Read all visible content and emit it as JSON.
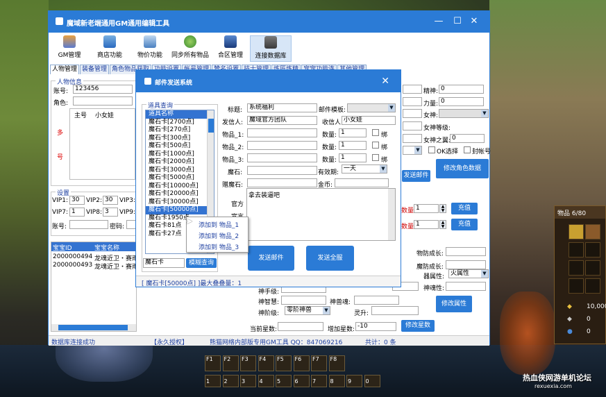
{
  "main_window": {
    "title": "魔域新老端通用GM通用编辑工具",
    "controls": {
      "minimize": "—",
      "maximize": "☐",
      "close": "✕"
    }
  },
  "toolbar": {
    "items": [
      {
        "label": "GM管理",
        "icon": "user-icon"
      },
      {
        "label": "商店功能",
        "icon": "shop-icon"
      },
      {
        "label": "物价功能",
        "icon": "price-icon"
      },
      {
        "label": "同步所有物品",
        "icon": "sync-icon"
      },
      {
        "label": "合区管理",
        "icon": "merge-icon"
      },
      {
        "label": "连接数据库",
        "icon": "database-icon"
      }
    ]
  },
  "tabs": [
    "人物管理",
    "装备管理",
    "角色物品获取",
    "功能设置",
    "帐号管理",
    "赞名设置",
    "技士管理",
    "炼匠炼精",
    "宠宠功能连",
    "其他管理"
  ],
  "character": {
    "group_title": "人物信息",
    "account_label": "账号:",
    "account_value": "123456",
    "role_label": "角色:",
    "role_list": {
      "col1": "主号",
      "col2": "小女娃",
      "side_label_1": "多",
      "side_label_2": "号"
    }
  },
  "right_panel": {
    "attr1_label": "精神:",
    "attr1_value": "0",
    "attr2_label": "力量:",
    "attr2_value": "0",
    "attr3_label": "女神:",
    "attr4_label": "女神等级:",
    "attr5_label": "女神之翼:",
    "attr5_value": "0",
    "check1": "OK选择",
    "check2": "封帐号",
    "modify_role_button": "修改角色数据",
    "send_mail_button": "发送邮件"
  },
  "vip_settings": {
    "group_title": "设置",
    "vip1_label": "VIP1:",
    "vip1_value": "30",
    "vip2_label": "VIP2:",
    "vip2_value": "30",
    "vip3_label": "VIP3:",
    "vip7_label": "VIP7:",
    "vip7_value": "1",
    "vip8_label": "VIP8:",
    "vip8_value": "3",
    "vip9_label": "VIP9:",
    "account_label": "账号:",
    "password_label": "密码:"
  },
  "pet_table": {
    "headers": [
      "宝宝ID",
      "宝宝名称"
    ],
    "rows": [
      [
        "2000000494",
        "龙魂近卫・赛雨"
      ],
      [
        "2000000493",
        "龙魂近卫・赛雨"
      ]
    ]
  },
  "recharge": {
    "row1_label": "数量:",
    "row1_value": "1",
    "row1_button": "充值",
    "row2_label": "数量:",
    "row2_value": "1",
    "row2_button": "充值"
  },
  "pet_attrs": {
    "growth_label": "物防成长:",
    "magic_growth_label": "魔防成长:",
    "element_label": "器属性:",
    "element_value": "火属性",
    "spirit_label": "神魂性:",
    "wisdom_label": "神智慧:",
    "level_label": "神阶级:",
    "level_value": "零阶神兽",
    "rank_label": "神手级:",
    "soul_label": "神兽魂:",
    "soul2_label": "灵升:",
    "modify_attr_button": "修改属性",
    "star_label": "当前星数:",
    "add_star_label": "增加星数:",
    "add_star_value": "-10",
    "modify_star_button": "修改星数"
  },
  "status_bar": {
    "db_status": "数据库连接成功",
    "license": "【永久授权】",
    "vendor": "熊猫网络内部版专用GM工具 QQ：847069216",
    "total": "共计：0 条"
  },
  "mail_window": {
    "title": "邮件发送系统",
    "item_query_title": "道具查询",
    "item_list": [
      "道具名称",
      "魔石卡[2700点]",
      "魔石卡[270点]",
      "魔石卡[300点]",
      "魔石卡[500点]",
      "魔石卡[1000点]",
      "魔石卡[2000点]",
      "魔石卡[3000点]",
      "魔石卡[5000点]",
      "魔石卡[10000点]",
      "魔石卡[20000点]",
      "魔石卡[30000点]",
      "魔石卡[50000点]",
      "魔石卡1950点",
      "魔石卡81点",
      "魔石卡27点"
    ],
    "selected_index": 12,
    "search_value": "魔石卡",
    "search_button": "模糊查询",
    "context_menu": [
      "添加到 物品_1",
      "添加到 物品_2",
      "添加到 物品_3"
    ],
    "subject_label": "标题:",
    "subject_value": "系统福利",
    "template_label": "邮件模板:",
    "sender_label": "发信人:",
    "sender_value": "魔域官方团队",
    "receiver_label": "收信人:",
    "receiver_value": "小女娃",
    "item1_label": "物品_1:",
    "item2_label": "物品_2:",
    "item3_label": "物品_3:",
    "qty_label": "数量:",
    "qty1_value": "1",
    "qty2_value": "1",
    "qty3_value": "1",
    "bind_label": "绑",
    "magic_stone_label": "魔石:",
    "validity_label": "有效期:",
    "validity_value": "一天",
    "bound_stone_label": "赠魔石:",
    "gold_label": "金币:",
    "body_value": "拿去装逼吧",
    "side_label_1": "官方",
    "side_label_2": "宣言",
    "send_button": "发送邮件",
    "send_all_button": "发送全服",
    "status_text": "[ 魔石卡[50000点] ]最大叠叠量：1"
  },
  "game_ui": {
    "inventory_title": "物品 6/80",
    "currency_1": "10,000",
    "currency_2": "0",
    "currency_3": "0",
    "fkeys": [
      "F1",
      "F2",
      "F3",
      "F4",
      "F5",
      "F6",
      "F7",
      "F8"
    ],
    "numkeys": [
      "1",
      "2",
      "3",
      "4",
      "5",
      "6",
      "7",
      "8",
      "9",
      "0"
    ],
    "watermark": "热血侠网游单机论坛",
    "watermark_url": "rexuexia.com"
  }
}
